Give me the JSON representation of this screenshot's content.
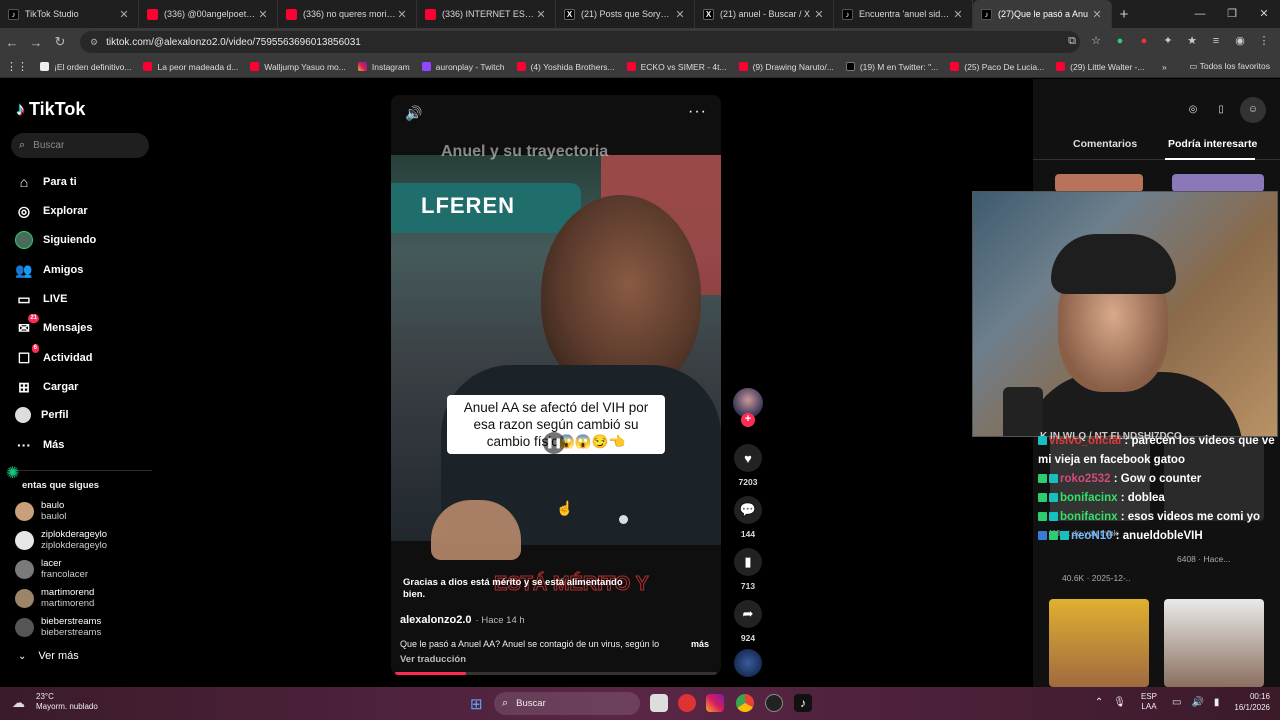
{
  "browser": {
    "tabs": [
      {
        "label": "TikTok Studio",
        "icon": "tiktok"
      },
      {
        "label": "(336) @00angelpoetry - Y",
        "icon": "youtube"
      },
      {
        "label": "(336) no queres morir so",
        "icon": "youtube"
      },
      {
        "label": "(336) INTERNET ESTÁ PO",
        "icon": "youtube"
      },
      {
        "label": "(21) Posts que Sorye (@E",
        "icon": "x"
      },
      {
        "label": "(21) anuel - Buscar / X",
        "icon": "x"
      },
      {
        "label": "Encuentra 'anuel sida' e",
        "icon": "tiktok"
      },
      {
        "label": "(27)Que le pasó a Anu",
        "icon": "tiktok",
        "active": true
      }
    ],
    "url": "tiktok.com/@alexalonzo2.0/video/7595563696013856031",
    "bookmarks": [
      {
        "label": "¡El orden definitivo...",
        "icon": "doc"
      },
      {
        "label": "La peor madeada d...",
        "icon": "youtube"
      },
      {
        "label": "Walljump Yasuo mo...",
        "icon": "youtube"
      },
      {
        "label": "Instagram",
        "icon": "instagram"
      },
      {
        "label": "auronplay - Twitch",
        "icon": "twitch"
      },
      {
        "label": "(4) Yoshida Brothers...",
        "icon": "youtube"
      },
      {
        "label": "ECKO vs SIMER - 4t...",
        "icon": "youtube"
      },
      {
        "label": "(9) Drawing Naruto/...",
        "icon": "youtube"
      },
      {
        "label": "(19) M en Twitter: \"...",
        "icon": "x"
      },
      {
        "label": "(25) Paco De Lucia...",
        "icon": "youtube"
      },
      {
        "label": "(29) Little Walter -...",
        "icon": "youtube"
      }
    ],
    "bookmarks_folder": "Todos los favoritos"
  },
  "sidebar": {
    "logo": "TikTok",
    "search_placeholder": "Buscar",
    "nav": [
      {
        "label": "Para ti",
        "icon": "home-icon"
      },
      {
        "label": "Explorar",
        "icon": "compass-icon"
      },
      {
        "label": "Siguiendo",
        "icon": "following-avatar-icon"
      },
      {
        "label": "Amigos",
        "icon": "friends-icon"
      },
      {
        "label": "LIVE",
        "icon": "live-icon"
      },
      {
        "label": "Mensajes",
        "icon": "messages-icon",
        "badge": "21"
      },
      {
        "label": "Actividad",
        "icon": "activity-icon",
        "badge": "6"
      },
      {
        "label": "Cargar",
        "icon": "upload-icon"
      },
      {
        "label": "Perfil",
        "icon": "profile-icon"
      },
      {
        "label": "Más",
        "icon": "more-icon"
      }
    ],
    "following_header": "entas que sigues",
    "accounts": [
      {
        "name": "baulo",
        "handle": "baulol"
      },
      {
        "name": "ziplokderageylo",
        "handle": "ziplokderageylo"
      },
      {
        "name": "lacer",
        "handle": "francolacer"
      },
      {
        "name": "martimorend",
        "handle": "martimorend"
      },
      {
        "name": "bieberstreams",
        "handle": "bieberstreams"
      }
    ],
    "see_more": "Ver más"
  },
  "video": {
    "caption": "Anuel AA se afectó del VIH por esa razon según cambió su cambio físic",
    "caption_emojis": "😱😱😏👈",
    "subtitle": "Gracias a dios está mérito y se está alimentando bien.",
    "overlay_text": "ESTÁ MÉRITO Y",
    "top_text": "Anuel y su trayectoria",
    "author": "alexalonzo2.0",
    "posted": "· Hace 14 h",
    "description": "Que le pasó a Anuel AA? Anuel se contagió de un virus, según lo",
    "more_label": "más",
    "translate_label": "Ver traducción",
    "progress": 0.22,
    "sign_text": "LFEREN"
  },
  "actions": {
    "likes": "7203",
    "comments": "144",
    "saves": "713",
    "shares": "924"
  },
  "right_panel": {
    "tab_comments": "Comentarios",
    "tab_interest": "Podría interesarte"
  },
  "chat": [
    {
      "user": "visivo_oficial",
      "text": "parecen los videos que ve mi vieja en facebook gatoo",
      "color": "red"
    },
    {
      "user": "roko2532",
      "text": "Gow o counter",
      "color": "pink"
    },
    {
      "user": "bonifacinx",
      "text": "doblea",
      "color": "green"
    },
    {
      "user": "bonifacinx",
      "text": "esos videos me comi yo",
      "color": "green"
    },
    {
      "user": "neoN10",
      "text": "anueldobleVIH",
      "color": "lblue"
    }
  ],
  "ghost_texts": {
    "top_cut": "K IN WLQ / NT FLNDSHI7DCO",
    "think": "What do you think",
    "views": "40.6K · 2025-12-..",
    "views2": "6408 · Hace..."
  },
  "taskbar": {
    "temp": "23°C",
    "weather": "Mayorm. nublado",
    "search": "Buscar",
    "lang1": "ESP",
    "lang2": "LAA",
    "time": "00:16",
    "date": "16/1/2026"
  }
}
